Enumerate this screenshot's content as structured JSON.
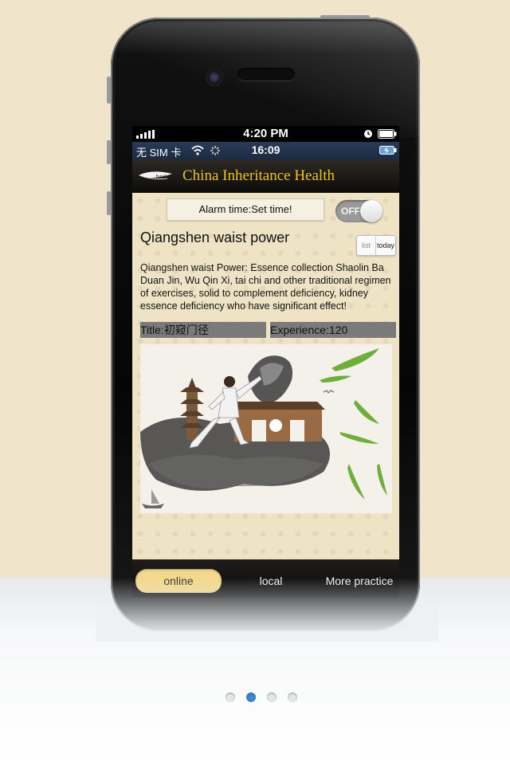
{
  "status_bar": {
    "time": "4:20 PM"
  },
  "sim_bar": {
    "carrier": "无 SIM 卡",
    "time": "16:09"
  },
  "header": {
    "back_label": "back",
    "title": "China Inheritance Health"
  },
  "alarm": {
    "label": "Alarm time:Set time!",
    "toggle_label": "OFF"
  },
  "article": {
    "title": "Qiangshen waist power",
    "view_toggle": {
      "list": "list",
      "today": "today"
    },
    "description": "Qiangshen waist Power: Essence collection Shaolin Ba Duan Jin, Wu Qin Xi, tai chi and other traditional regimen of exercises, solid to complement deficiency, kidney essence deficiency who have significant effect!",
    "title_tag": "Title:初窥门径",
    "experience_tag": "Experience:120"
  },
  "tabs": [
    {
      "label": "online",
      "active": true
    },
    {
      "label": "local",
      "active": false
    },
    {
      "label": "More practice",
      "active": false
    }
  ],
  "page_indicator": {
    "count": 4,
    "current": 2
  },
  "colors": {
    "background": "#f0e4cb",
    "title_gold": "#f0c21e",
    "tab_active": "#f2d88c",
    "dot_active": "#3c87cf",
    "tag_bg": "#7a7a7a"
  },
  "icons": [
    "signal-icon",
    "wifi-icon",
    "loading-icon",
    "alarm-clock-icon",
    "battery-icon",
    "charging-battery-icon",
    "back-feather-icon"
  ]
}
